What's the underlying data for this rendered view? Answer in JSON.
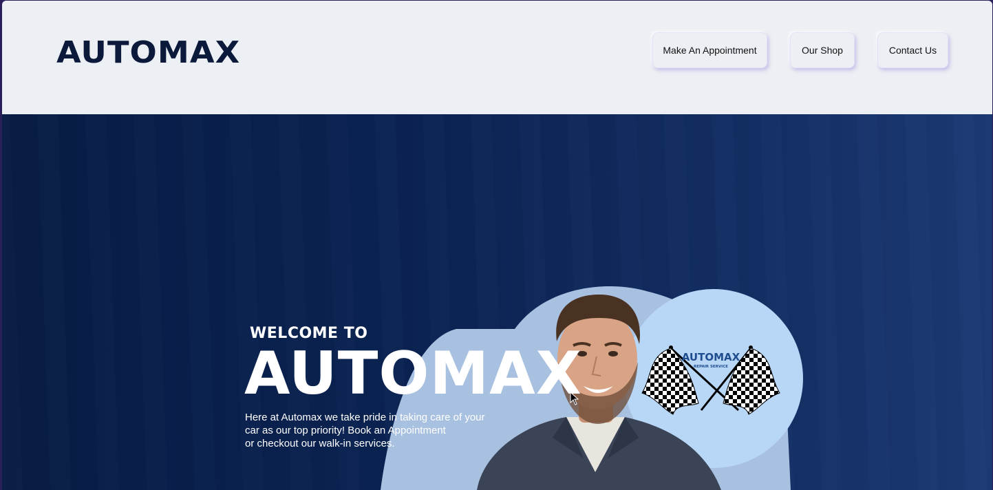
{
  "header": {
    "logo": "AUTOMAX",
    "nav": [
      {
        "label": "Make An Appointment"
      },
      {
        "label": "Our Shop"
      },
      {
        "label": "Contact Us"
      }
    ]
  },
  "hero": {
    "welcome": "WELCOME TO",
    "title": "AUTOMAX",
    "tagline_lines": [
      "Here at Automax we take pride in taking care of your",
      "car as our top priority! Book an Appointment",
      "or checkout our walk-in services."
    ],
    "badge": {
      "brand": "AUTOMAX",
      "sub": "REPAIR SERVICE"
    }
  },
  "colors": {
    "brand_dark": "#0b1a3a",
    "hero_bg": "#0b2454",
    "shape_light": "#a9c1e0",
    "badge_bg": "#b8d6f6",
    "badge_text": "#1f4d8f"
  },
  "icons": [
    "checkered-flags-icon",
    "cursor-icon"
  ]
}
